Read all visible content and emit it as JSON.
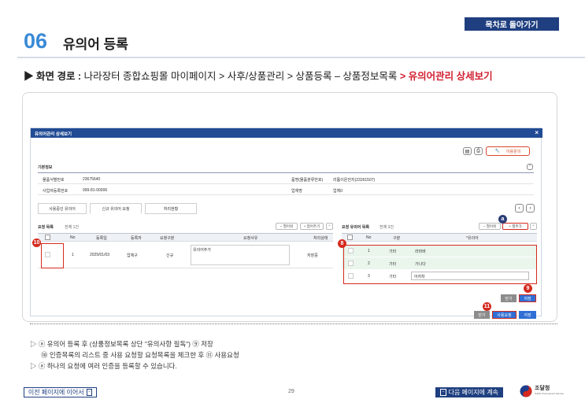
{
  "header": {
    "back_label": "목차로 돌아가기",
    "section_number": "06",
    "section_title": "유의어 등록"
  },
  "path": {
    "prefix": "▶ 화면 경로 : ",
    "route": "나라장터 종합쇼핑몰 마이페이지 > 사후/상품관리 > 상품등록 – 상품정보목록 ",
    "highlight": "> 유의어관리 상세보기"
  },
  "modal": {
    "title": "유의어관리 상세보기",
    "close": "×",
    "top_icons": [
      "엑셀",
      "인쇄"
    ],
    "inquiry_label": "이용문의",
    "basic_info_label": "기본정보",
    "fields": {
      "product_id_label": "물품식별번호",
      "product_id_value": "23675640",
      "class_label": "품명(물품분류번호)",
      "class_value": "리튬이온전지(23261507)",
      "biz_no_label": "사업자등록번호",
      "biz_no_value": "999-81-00006",
      "company_label": "업체명",
      "company_value": "업체0"
    },
    "tabs": [
      "사용중인 유의어",
      "신규 유의어 요청",
      "처리현황"
    ],
    "request_list": {
      "title": "요청 목록",
      "count": "전체 1건",
      "collapse": "− 열어줘",
      "expand": "+ 접어주기",
      "headers": [
        "No",
        "등록일",
        "등록자",
        "요청구분",
        "요청사유",
        "처리상태"
      ],
      "rows": [
        {
          "no": "1",
          "date": "2025/01/03",
          "user": "업체구",
          "type": "신규",
          "reason": "유의어추가",
          "status": "저장중"
        }
      ]
    },
    "synonym_list": {
      "title": "요청 유의어 목록",
      "count": "전체 3건",
      "collapse": "− 열어줘",
      "expand": "+ 행추가",
      "headers": [
        "No",
        "구분",
        "*유의어"
      ],
      "rows": [
        {
          "no": "1",
          "type": "기타",
          "word": "라마바"
        },
        {
          "no": "2",
          "type": "기타",
          "word": "가나다"
        },
        {
          "no": "3",
          "type": "기타",
          "word": "아자차"
        }
      ]
    },
    "buttons": {
      "close": "닫기",
      "save": "저장",
      "close2": "닫기",
      "use_request": "사용요청",
      "save2": "저장"
    },
    "badges": {
      "a": "a",
      "b8": "8",
      "b9": "9",
      "b10": "10",
      "b11": "11"
    }
  },
  "notes": {
    "line1": "▷ ⓐ 유의어 등록 후 (상품정보목록 상단 \"유의사항 필독\") ⑨ 저장",
    "line2": "⑩ 인증목록의 리스트 중 사용 요청할 요청목록을 체크한 후 ⑪ 사용요청",
    "line3": "▷ ⓐ 하나의 요청에 여러 인증을 등록할 수 있습니다."
  },
  "footer": {
    "prev_label": "이전 페이지에 이어서",
    "page_number": "29",
    "next_label": "다음 페이지에 계속",
    "logo_text": "조달청",
    "logo_sub": "Public Procurement Service"
  },
  "colors": {
    "brand": "#1f3f80",
    "accent": "#3a8ad6",
    "highlight": "#d1202f"
  }
}
